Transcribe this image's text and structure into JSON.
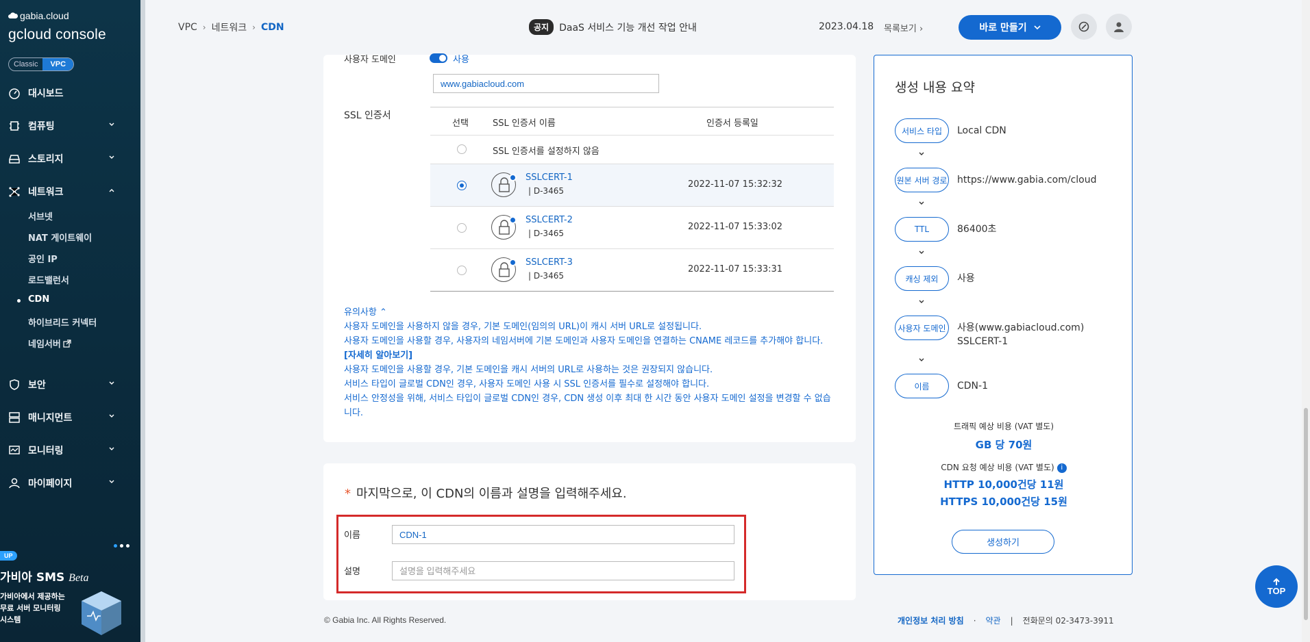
{
  "sidebar": {
    "logo_top": "gabia.cloud",
    "logo_main": "gcloud console",
    "toggle": {
      "classic": "Classic",
      "vpc": "VPC"
    },
    "menu": [
      {
        "label": "대시보드",
        "icon": "dashboard-icon"
      },
      {
        "label": "컴퓨팅",
        "icon": "chip-icon"
      },
      {
        "label": "스토리지",
        "icon": "storage-icon"
      },
      {
        "label": "네트워크",
        "icon": "network-icon"
      },
      {
        "label": "보안",
        "icon": "shield-icon"
      },
      {
        "label": "매니지먼트",
        "icon": "management-icon"
      },
      {
        "label": "모니터링",
        "icon": "monitor-icon"
      },
      {
        "label": "마이페이지",
        "icon": "user-icon"
      }
    ],
    "network_sub": [
      "서브넷",
      "NAT 게이트웨이",
      "공인 IP",
      "로드밸런서",
      "CDN",
      "하이브리드 커넥터",
      "네임서버"
    ],
    "ad": {
      "badge": "UP",
      "title": "가비아 SMS",
      "title_italic": "Beta",
      "desc": "가비아에서 제공하는\n무료 서버 모니터링\n시스템"
    }
  },
  "header": {
    "breadcrumb": [
      "VPC",
      "네트워크",
      "CDN"
    ],
    "notice_tag": "공지",
    "notice_text": "DaaS 서비스 기능 개선 작업 안내",
    "date": "2023.04.18",
    "list_view": "목록보기",
    "create_button": "바로 만들기"
  },
  "form": {
    "user_domain_label": "사용자 도메인",
    "user_domain_toggle": "사용",
    "user_domain_value": "www.gabiacloud.com",
    "ssl_label": "SSL 인증서",
    "ssl_table": {
      "headers": [
        "선택",
        "SSL 인증서 이름",
        "인증서 등록일"
      ],
      "none_option": "SSL 인증서를 설정하지 않음",
      "rows": [
        {
          "name": "SSLCERT-1",
          "id": "|  D-3465",
          "date": "2022-11-07 15:32:32",
          "selected": true
        },
        {
          "name": "SSLCERT-2",
          "id": "|  D-3465",
          "date": "2022-11-07 15:33:02",
          "selected": false
        },
        {
          "name": "SSLCERT-3",
          "id": "|  D-3465",
          "date": "2022-11-07 15:33:31",
          "selected": false
        }
      ]
    },
    "notes": {
      "title": "유의사항",
      "line1": "사용자 도메인을 사용하지 않을 경우, 기본 도메인(임의의 URL)이 캐시 서버 URL로 설정됩니다.",
      "line2": "사용자 도메인을 사용할 경우, 사용자의 네임서버에 기본 도메인과 사용자 도메인을 연결하는 CNAME 레코드를 추가해야 합니다.",
      "learn_more": "[자세히 알아보기]",
      "line3": "사용자 도메인을 사용할 경우, 기본 도메인을 캐시 서버의 URL로 사용하는 것은 권장되지 않습니다.",
      "line4": "서비스 타입이 글로벌 CDN인 경우, 사용자 도메인 사용 시 SSL 인증서를 필수로 설정해야 합니다.",
      "line5": "서비스 안정성을 위해, 서비스 타입이 글로벌 CDN인 경우, CDN 생성 이후 최대 한 시간 동안 사용자 도메인 설정을 변경할 수 없습니다."
    },
    "final_step": {
      "star": "*",
      "title": "마지막으로, 이 CDN의 이름과 설명을 입력해주세요.",
      "name_label": "이름",
      "name_value": "CDN-1",
      "desc_label": "설명",
      "desc_placeholder": "설명을 입력해주세요"
    }
  },
  "summary": {
    "title": "생성 내용 요약",
    "items": [
      {
        "key": "서비스 타입",
        "value": "Local CDN"
      },
      {
        "key": "원본 서버 경로",
        "value": "https://www.gabia.com/cloud"
      },
      {
        "key": "TTL",
        "value": "86400초"
      },
      {
        "key": "캐싱 제외",
        "value": "사용"
      },
      {
        "key": "사용자 도메인",
        "value": "사용(www.gabiacloud.com)",
        "value2": "SSLCERT-1"
      },
      {
        "key": "이름",
        "value": "CDN-1"
      }
    ],
    "traffic_label": "트래픽 예상 비용 (VAT 별도)",
    "traffic_value": "GB 당 70원",
    "request_label": "CDN 요청 예상 비용 (VAT 별도)",
    "http_value": "HTTP 10,000건당 11원",
    "https_value": "HTTPS 10,000건당 15원",
    "create_button": "생성하기"
  },
  "footer": {
    "copyright": "© Gabia Inc. All Rights Reserved.",
    "privacy": "개인정보 처리 방침",
    "dot": "·",
    "terms": "약관",
    "sep": "|",
    "contact": "전화문의  02-3473-3911"
  },
  "top_button": "TOP",
  "colors": {
    "primary": "#1469d0",
    "sidebar": "#0d3448",
    "highlight": "#d42a2a"
  }
}
